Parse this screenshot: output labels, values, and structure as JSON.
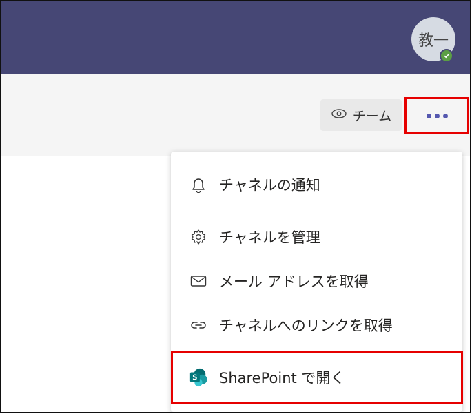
{
  "topbar": {
    "avatar_initial": "教一",
    "presence_status": "available"
  },
  "header": {
    "team_button_label": "チーム",
    "more_options_icon": "ellipsis-icon"
  },
  "menu": {
    "items": [
      {
        "label": "チャネルの通知",
        "icon": "bell-icon"
      },
      {
        "label": "チャネルを管理",
        "icon": "gear-icon"
      },
      {
        "label": "メール アドレスを取得",
        "icon": "envelope-icon"
      },
      {
        "label": "チャネルへのリンクを取得",
        "icon": "link-icon"
      },
      {
        "label": "SharePoint で開く",
        "icon": "sharepoint-icon"
      }
    ]
  },
  "colors": {
    "topbar": "#464775",
    "accent": "#5558af",
    "highlight": "#e60000",
    "presence": "#5b9f44",
    "sharepoint": "#038387"
  }
}
